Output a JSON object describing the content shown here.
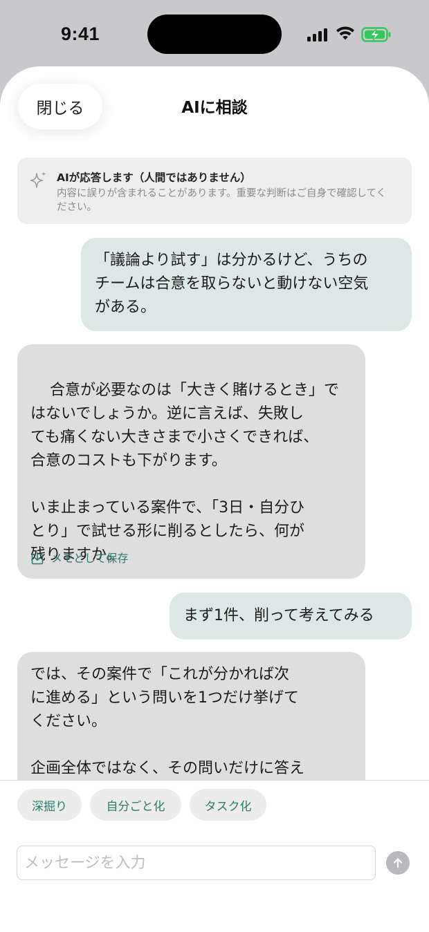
{
  "status_bar": {
    "time": "9:41",
    "battery_color": "#34c759"
  },
  "header": {
    "close_label": "閉じる",
    "title": "AIに相談"
  },
  "notice": {
    "icon": "sparkle-icon",
    "title": "AIが応答します（人間ではありません）",
    "body": "内容に誤りが含まれることがあります。重要な判断はご自身で確認してください。"
  },
  "messages": [
    {
      "role": "user",
      "text": "「議論より試す」は分かるけど、うちの\nチームは合意を取らないと動けない空気\nがある。"
    },
    {
      "role": "ai",
      "text": "合意が必要なのは「大きく賭けるとき」で\nはないでしょうか。逆に言えば、失敗し\nても痛くない大きさまで小さくできれば、\n合意のコストも下がります。\n\nいま止まっている案件で、「3日・自分ひ\nとり」で試せる形に削るとしたら、何が\n残りますか。",
      "action_label": "メモとして保存",
      "action_icon": "download-icon"
    },
    {
      "role": "user",
      "text": "まず1件、削って考えてみる"
    },
    {
      "role": "ai",
      "text": "では、その案件で「これが分かれば次\nに進める」という問いを1つだけ挙げて\nください。\n\n企画全体ではなく、その問いだけに答え"
    }
  ],
  "suggestions": [
    "深掘り",
    "自分ごと化",
    "タスク化"
  ],
  "composer": {
    "placeholder": "メッセージを入力",
    "send_icon": "arrow-up-icon"
  },
  "colors": {
    "accent": "#2e7a6e",
    "user_bubble": "#dce8e5",
    "ai_bubble": "#dedede"
  }
}
